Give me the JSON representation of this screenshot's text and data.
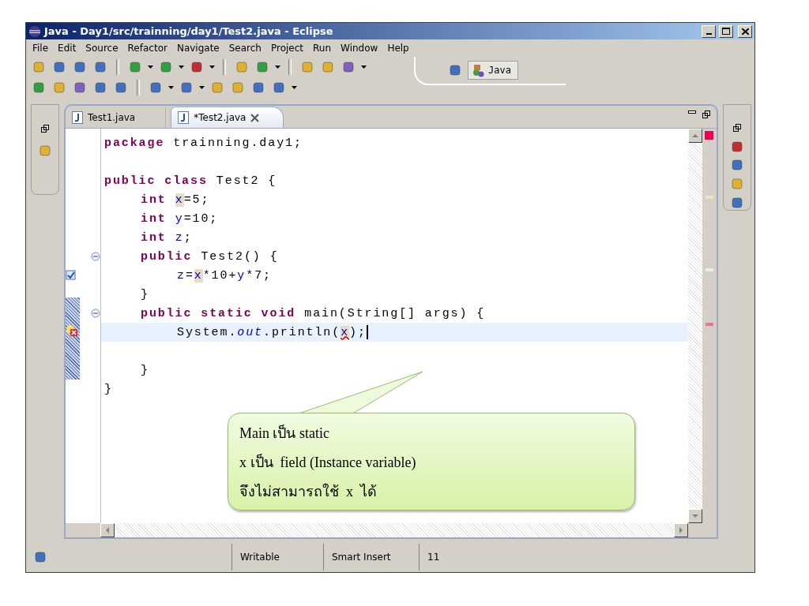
{
  "window": {
    "title": "Java - Day1/src/trainning/day1/Test2.java - Eclipse"
  },
  "menu": [
    "File",
    "Edit",
    "Source",
    "Refactor",
    "Navigate",
    "Search",
    "Project",
    "Run",
    "Window",
    "Help"
  ],
  "perspective": {
    "label": "Java",
    "selected": true
  },
  "editor_tabs": [
    {
      "label": "Test1.java",
      "selected": false
    },
    {
      "label": "*Test2.java",
      "selected": true
    }
  ],
  "code_lines": [
    {
      "tokens": [
        {
          "kind": "keyword",
          "text": "package"
        },
        {
          "kind": "plain",
          "text": "trainning.day1;"
        }
      ],
      "current": false,
      "task": false,
      "problem": false,
      "fold": false
    },
    {
      "current": false,
      "task": false,
      "problem": false,
      "fold": false
    },
    {
      "tokens": [
        {
          "kind": "keyword",
          "text": "public class"
        },
        {
          "kind": "plain",
          "text": "Test2 {"
        }
      ],
      "current": false,
      "task": false,
      "problem": false,
      "fold": false,
      "children": [
        {
          "tokens": [
            {
              "kind": "keyword",
              "text": "int"
            },
            {
              "kind": "field",
              "text": "x",
              "highlighted": true,
              "error": false
            },
            {
              "kind": "plain",
              "text": "=5;"
            }
          ],
          "current": false,
          "task": false,
          "problem": false,
          "fold": false
        },
        {
          "tokens": [
            {
              "kind": "keyword",
              "text": "int"
            },
            {
              "kind": "field",
              "text": "y",
              "highlighted": false,
              "error": false
            },
            {
              "kind": "plain",
              "text": "=10;"
            }
          ],
          "current": false,
          "task": false,
          "problem": false,
          "fold": false
        },
        {
          "tokens": [
            {
              "kind": "keyword",
              "text": "int"
            },
            {
              "kind": "field",
              "text": "z",
              "highlighted": false,
              "error": false
            },
            {
              "kind": "plain",
              "text": ";"
            }
          ],
          "current": false,
          "task": false,
          "problem": false,
          "fold": false
        },
        {
          "tokens": [
            {
              "kind": "keyword",
              "text": "public"
            },
            {
              "kind": "plain",
              "text": "Test2() {"
            }
          ],
          "current": false,
          "task": false,
          "problem": false,
          "fold": true,
          "children": [
            {
              "tokens": [
                {
                  "kind": "field",
                  "text": "z",
                  "highlighted": false,
                  "error": false
                },
                {
                  "kind": "plain",
                  "text": "="
                },
                {
                  "kind": "field",
                  "text": "x",
                  "highlighted": true,
                  "error": false
                },
                {
                  "kind": "plain",
                  "text": "*10+"
                },
                {
                  "kind": "field",
                  "text": "y",
                  "highlighted": false,
                  "error": false
                },
                {
                  "kind": "plain",
                  "text": "*7;"
                }
              ],
              "current": false,
              "task": true,
              "problem": false,
              "fold": false
            }
          ]
        },
        {
          "tokens": [
            {
              "kind": "plain",
              "text": "}"
            }
          ],
          "current": false,
          "task": false,
          "problem": false,
          "fold": false
        },
        {
          "tokens": [
            {
              "kind": "keyword",
              "text": "public static void"
            },
            {
              "kind": "plain",
              "text": "main(String[] args) {"
            }
          ],
          "current": false,
          "task": false,
          "problem": false,
          "fold": true,
          "children": [
            {
              "tokens": [
                {
                  "kind": "plain",
                  "text": "System."
                },
                {
                  "kind": "static",
                  "text": "out"
                },
                {
                  "kind": "plain",
                  "text": ".println("
                },
                {
                  "kind": "field",
                  "text": "x",
                  "highlighted": true,
                  "error": true
                },
                {
                  "kind": "plain",
                  "text": ");"
                }
              ],
              "current": true,
              "task": false,
              "problem": true,
              "fold": false
            },
            {
              "current": false,
              "task": false,
              "problem": false,
              "fold": false
            }
          ]
        },
        {
          "tokens": [
            {
              "kind": "plain",
              "text": "}"
            }
          ],
          "current": false,
          "task": false,
          "problem": false,
          "fold": false
        }
      ]
    },
    {
      "tokens": [
        {
          "kind": "plain",
          "text": "}"
        }
      ],
      "current": false,
      "task": false,
      "problem": false,
      "fold": false
    }
  ],
  "callout": {
    "lines": [
      "Main เป็น static",
      "x เป็น  field (Instance variable)",
      "จึงไม่สามารถใช้  x  ได้"
    ]
  },
  "status_bar": {
    "fields": [
      "Writable",
      "Smart Insert",
      "11"
    ]
  }
}
